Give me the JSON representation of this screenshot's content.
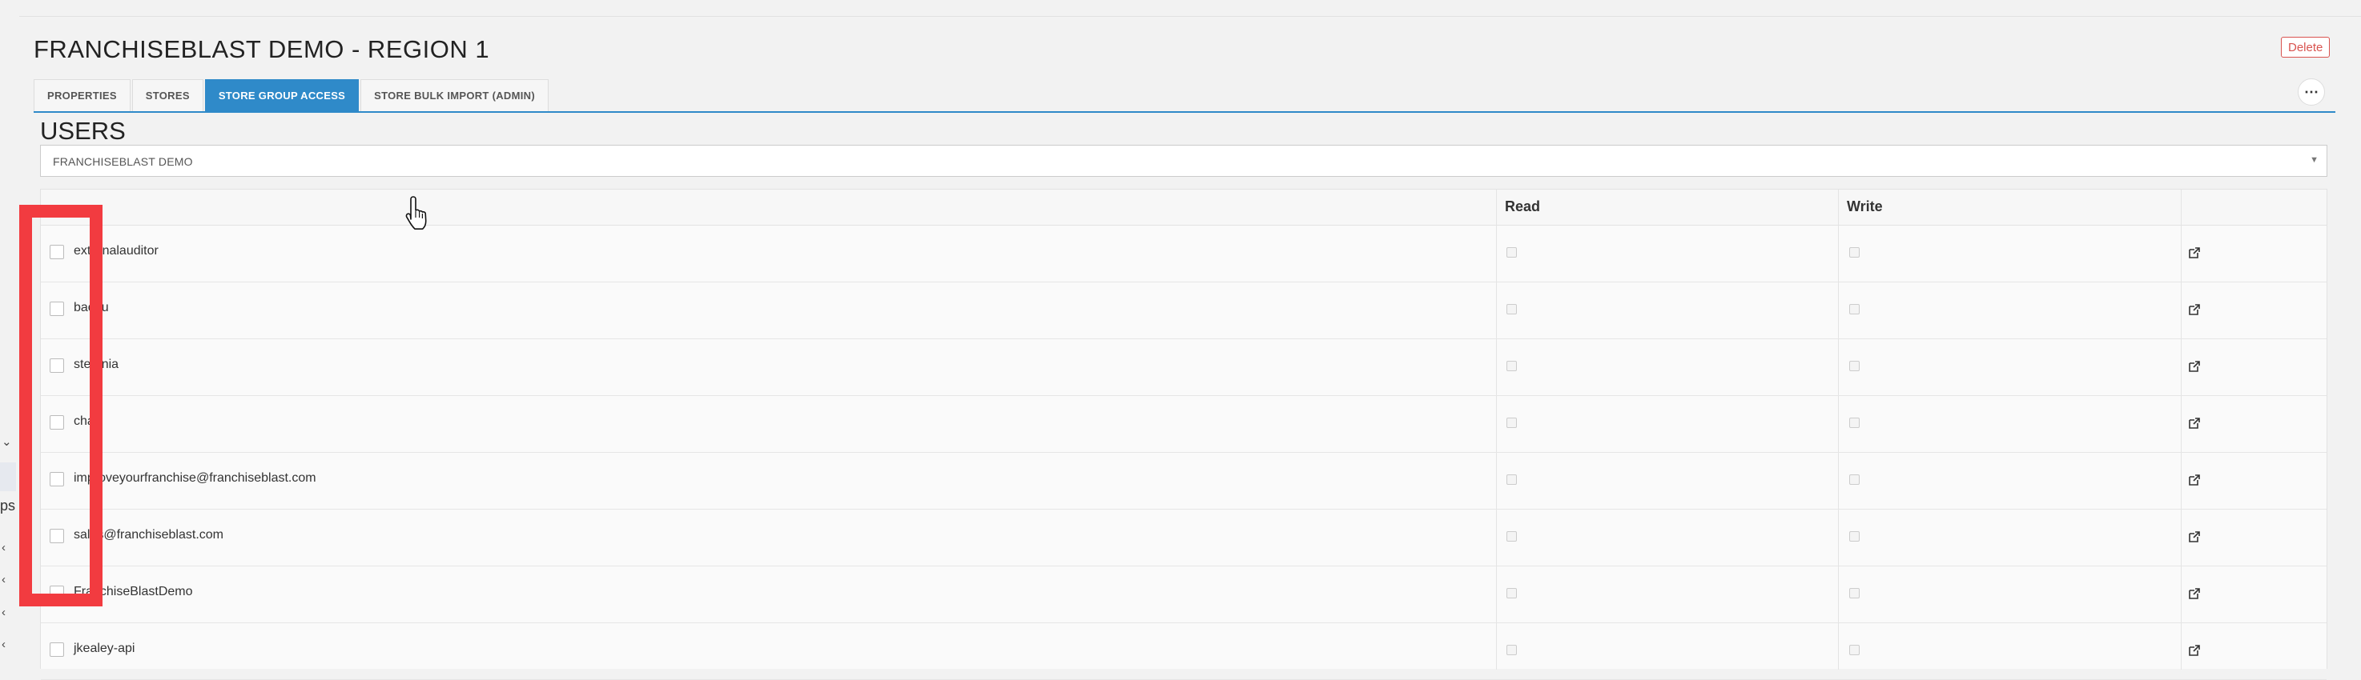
{
  "page": {
    "title": "FRANCHISEBLAST DEMO - REGION 1",
    "delete_label": "Delete",
    "more_label": "⋯"
  },
  "tabs": [
    {
      "label": "PROPERTIES",
      "active": false
    },
    {
      "label": "STORES",
      "active": false
    },
    {
      "label": "STORE GROUP ACCESS",
      "active": true
    },
    {
      "label": "STORE BULK IMPORT (ADMIN)",
      "active": false
    }
  ],
  "users": {
    "title": "USERS",
    "select_value": "FRANCHISEBLAST DEMO",
    "columns": {
      "read": "Read",
      "write": "Write"
    },
    "rows": [
      {
        "name": "externalauditor"
      },
      {
        "name": "baoxu"
      },
      {
        "name": "stefania"
      },
      {
        "name": "chan"
      },
      {
        "name": "improveyourfranchise@franchiseblast.com"
      },
      {
        "name": "sales@franchiseblast.com"
      },
      {
        "name": "FranchiseBlastDemo"
      },
      {
        "name": "jkealey-api"
      }
    ]
  },
  "sidebar": {
    "fragment_text": "ps",
    "chevrons": [
      "chevron-down",
      "chevron-left",
      "chevron-left",
      "chevron-left",
      "chevron-left"
    ]
  },
  "colors": {
    "accent": "#2f8ac9",
    "danger": "#d9534f",
    "highlight": "#f23b40"
  }
}
